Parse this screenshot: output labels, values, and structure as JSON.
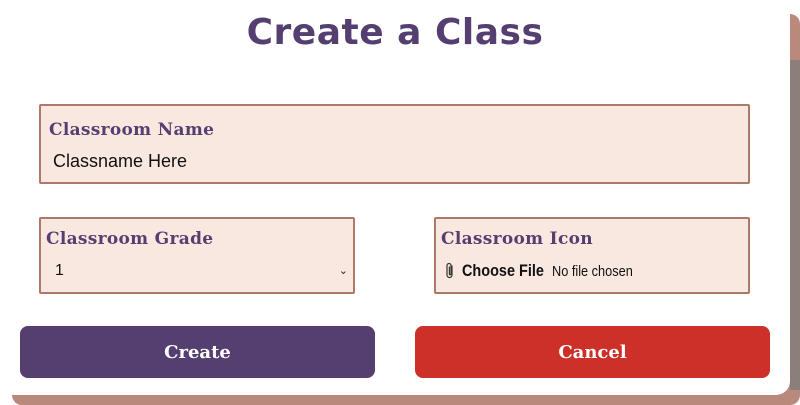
{
  "modal": {
    "title": "Create a Class",
    "colors": {
      "primary": "#553e70",
      "danger": "#cc3028",
      "field_bg": "#f9e8e0",
      "field_border": "#b0786a"
    }
  },
  "fields": {
    "name": {
      "label": "Classroom Name",
      "value": "Classname Here"
    },
    "grade": {
      "label": "Classroom Grade",
      "selected": "1",
      "chevron_icon": "chevron-down-icon"
    },
    "icon": {
      "label": "Classroom Icon",
      "choose_label": "Choose File",
      "no_file_text": "No file chosen",
      "attach_icon": "paperclip-icon"
    }
  },
  "actions": {
    "create_label": "Create",
    "cancel_label": "Cancel"
  }
}
